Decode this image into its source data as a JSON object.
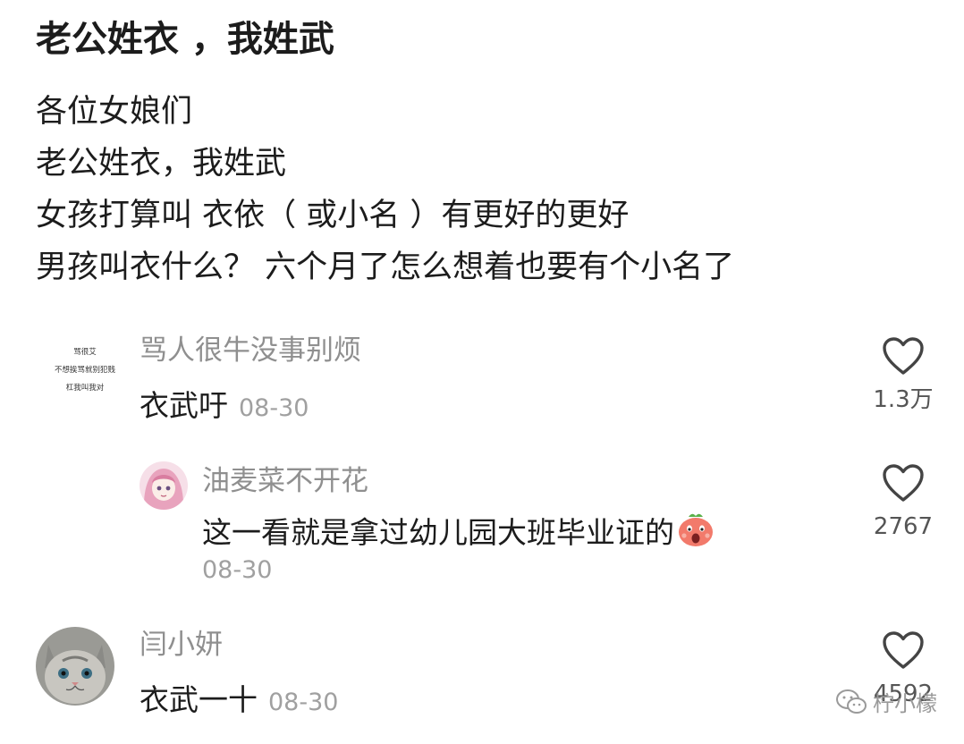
{
  "post": {
    "title": "老公姓衣 ，我姓武",
    "lines": [
      "各位女娘们",
      "老公姓衣，我姓武",
      "女孩打算叫 衣依（ 或小名 ）有更好的更好",
      "男孩叫衣什么？ 六个月了怎么想着也要有个小名了"
    ]
  },
  "comments": [
    {
      "avatar_lines": [
        "骂很艾",
        "不想挨骂就别犯贱",
        "杠我叫我对"
      ],
      "username": "骂人很牛没事别烦",
      "text": "衣武吁",
      "date": "08-30",
      "likes": "1.3万"
    },
    {
      "username": "油麦菜不开花",
      "text": "这一看就是拿过幼儿园大班毕业证的",
      "date": "08-30",
      "likes": "2767",
      "emoji": "shocked-face-emoji"
    },
    {
      "username": "闫小妍",
      "text": "衣武一十",
      "date": "08-30",
      "likes": "4592"
    }
  ],
  "watermark": {
    "text": "柠小檬",
    "icon": "wechat-icon"
  },
  "colors": {
    "text": "#1c1c1c",
    "username": "#8f8f8f",
    "date": "#a0a0a0",
    "heart": "#444444"
  }
}
